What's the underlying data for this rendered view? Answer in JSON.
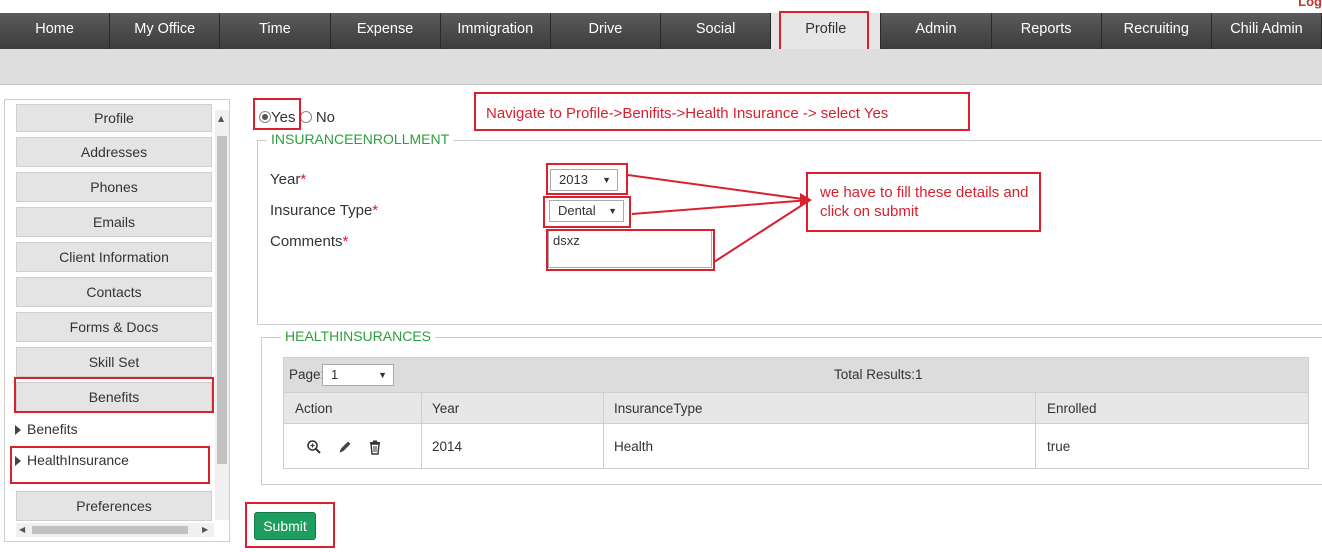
{
  "top_right_text": "Log",
  "nav": [
    {
      "label": "Home"
    },
    {
      "label": "My Office"
    },
    {
      "label": "Time"
    },
    {
      "label": "Expense"
    },
    {
      "label": "Immigration"
    },
    {
      "label": "Drive"
    },
    {
      "label": "Social"
    },
    {
      "label": "Profile"
    },
    {
      "label": "Admin"
    },
    {
      "label": "Reports"
    },
    {
      "label": "Recruiting"
    },
    {
      "label": "Chili Admin"
    }
  ],
  "sidebar": {
    "buttons": [
      "Profile",
      "Addresses",
      "Phones",
      "Emails",
      "Client Information",
      "Contacts",
      "Forms & Docs",
      "Skill Set",
      "Benefits"
    ],
    "tree": [
      "Benefits",
      "HealthInsurance"
    ],
    "bottom_button": "Preferences"
  },
  "radio": {
    "yes": "Yes",
    "no": "No"
  },
  "enrollment": {
    "legend": "INSURANCEENROLLMENT",
    "year_label": "Year",
    "year_value": "2013",
    "type_label": "Insurance Type",
    "type_value": "Dental",
    "comments_label": "Comments",
    "comments_value": "dsxz",
    "required_mark": "*"
  },
  "health": {
    "legend": "HEALTHINSURANCES",
    "page_label": "Page:",
    "page_value": "1",
    "total": "Total Results:1",
    "columns": [
      "Action",
      "Year",
      "InsuranceType",
      "Enrolled"
    ],
    "rows": [
      {
        "year": "2014",
        "type": "Health",
        "enrolled": "true"
      }
    ]
  },
  "submit_label": "Submit",
  "annotations": {
    "navigate": "Navigate to Profile->Benifits->Health Insurance -> select Yes",
    "fill": "we have to fill these details and click on submit"
  }
}
